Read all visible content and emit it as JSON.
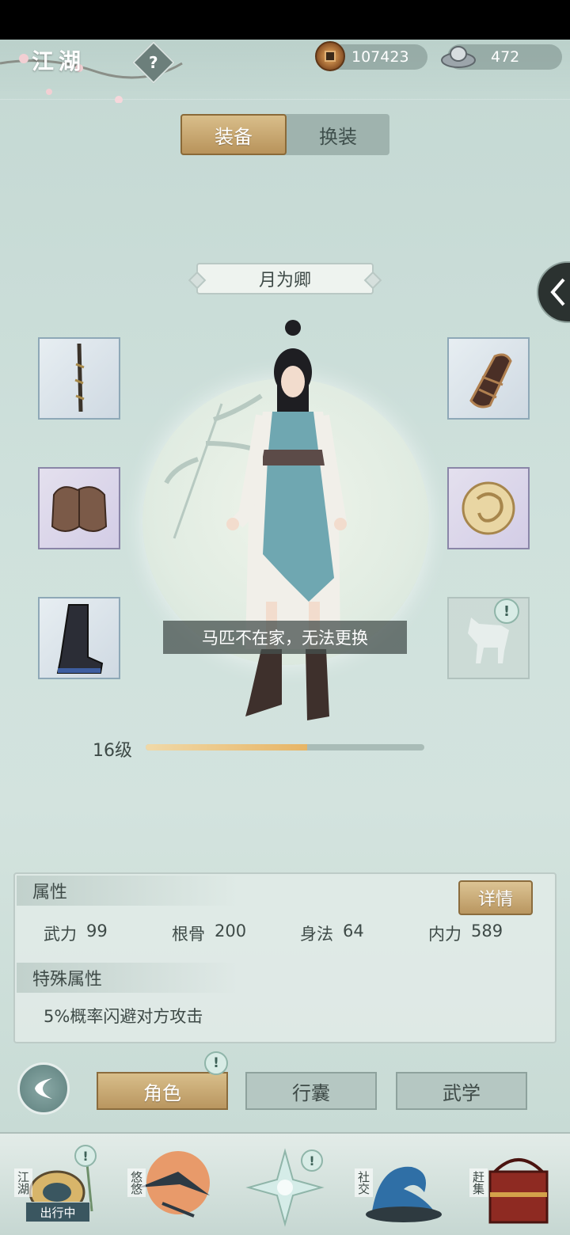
{
  "header": {
    "title": "江湖",
    "help_icon": "?",
    "coins": "107423",
    "silver": "472"
  },
  "tabs": [
    {
      "label": "装备",
      "active": true
    },
    {
      "label": "换装",
      "active": false
    }
  ],
  "character": {
    "name": "月为卿",
    "level_label": "16级",
    "level_progress": 0.58
  },
  "equipment_slots": {
    "left": [
      "weapon-icon",
      "armor-icon",
      "boots-icon"
    ],
    "right": [
      "bracer-icon",
      "jade-pendant-icon",
      "horse-icon"
    ]
  },
  "toast": "马匹不在家，无法更换",
  "attributes": {
    "header": "属性",
    "detail_button": "详情",
    "stats": [
      {
        "name": "武力",
        "value": "99"
      },
      {
        "name": "根骨",
        "value": "200"
      },
      {
        "name": "身法",
        "value": "64"
      },
      {
        "name": "内力",
        "value": "589"
      }
    ],
    "special_header": "特殊属性",
    "special_text": "5%概率闪避对方攻击"
  },
  "bottom_nav": [
    {
      "label": "角色",
      "active": true
    },
    {
      "label": "行囊",
      "active": false
    },
    {
      "label": "武学",
      "active": false
    }
  ],
  "dock": {
    "items": [
      {
        "label": "江湖",
        "icon": "jianghu-icon"
      },
      {
        "label": "悠悠",
        "icon": "swallow-icon"
      },
      {
        "label": "",
        "icon": "compass-star-icon"
      },
      {
        "label": "社交",
        "icon": "wave-icon"
      },
      {
        "label": "赶集",
        "icon": "market-box-icon"
      }
    ],
    "status_badge": "出行中",
    "alert_symbol": "!"
  },
  "colors": {
    "accent_gold": "#b99660",
    "background": "#c9dcd6"
  }
}
